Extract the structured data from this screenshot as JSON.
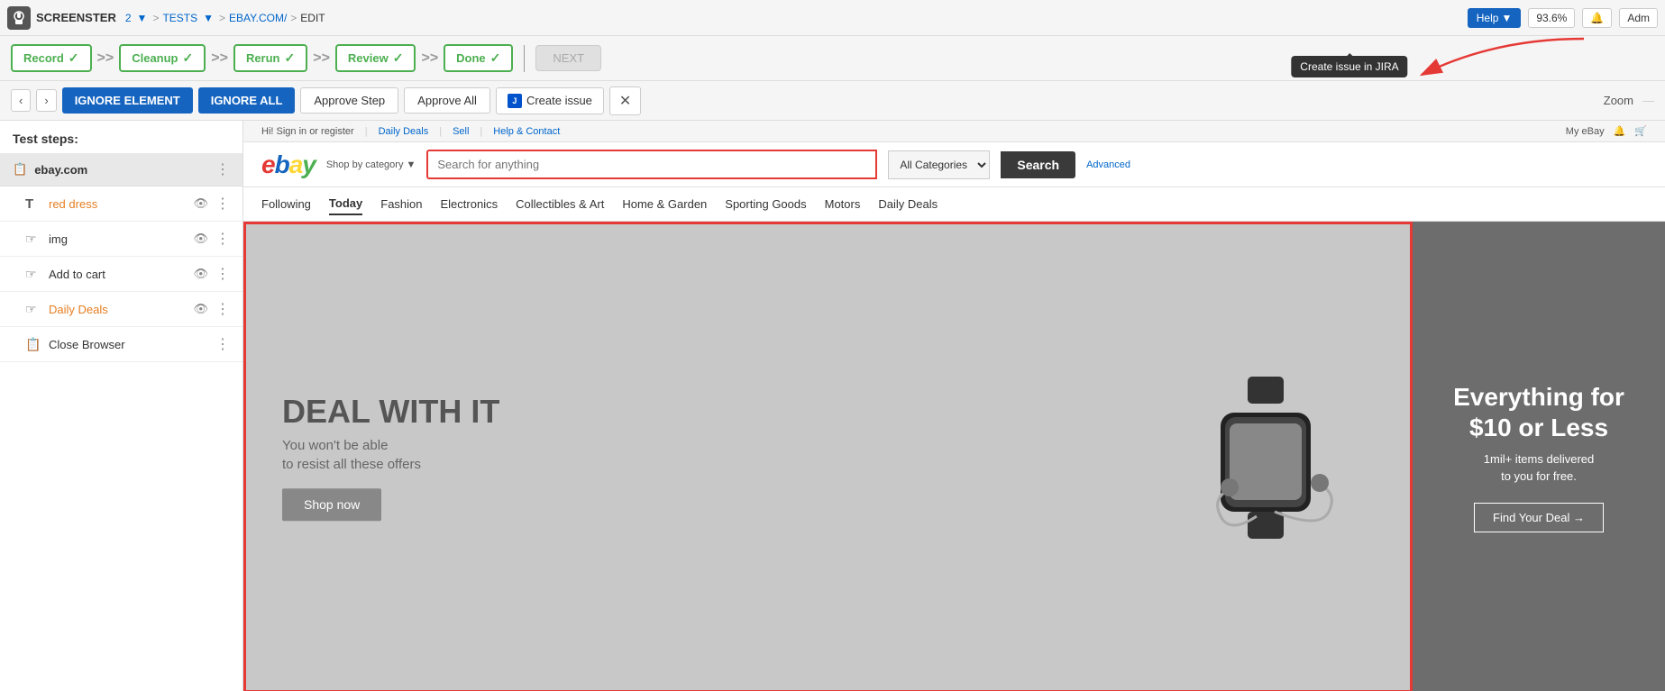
{
  "app": {
    "logo": "S",
    "name": "SCREENSTER"
  },
  "header": {
    "breadcrumb": {
      "num": "2",
      "tests": "TESTS",
      "site": "EBAY.COM/",
      "action": "EDIT"
    },
    "help_label": "Help",
    "zoom": "93.6%",
    "adm": "Adm"
  },
  "workflow": {
    "record_label": "Record",
    "cleanup_label": "Cleanup",
    "rerun_label": "Rerun",
    "review_label": "Review",
    "done_label": "Done",
    "next_label": "NEXT"
  },
  "tooltip": {
    "create_issue_jira": "Create issue in JIRA"
  },
  "action_bar": {
    "ignore_element_label": "IGNORE ELEMENT",
    "ignore_all_label": "IGNORE ALL",
    "approve_step_label": "Approve Step",
    "approve_all_label": "Approve All",
    "create_issue_label": "Create issue",
    "zoom_label": "Zoom"
  },
  "sidebar": {
    "title": "Test steps:",
    "group": {
      "icon": "📋",
      "name": "ebay.com"
    },
    "items": [
      {
        "icon": "T",
        "label": "red dress",
        "color": "orange",
        "type": "text"
      },
      {
        "icon": "👆",
        "label": "img",
        "color": "normal",
        "type": "click"
      },
      {
        "icon": "👆",
        "label": "Add to cart",
        "color": "normal",
        "type": "click"
      },
      {
        "icon": "👆",
        "label": "Daily Deals",
        "color": "orange",
        "type": "click"
      },
      {
        "icon": "📋",
        "label": "Close Browser",
        "color": "normal",
        "type": "browser"
      }
    ]
  },
  "ebay": {
    "topbar": {
      "greeting": "Hi! Sign in or register",
      "daily_deals": "Daily Deals",
      "sell": "Sell",
      "help": "Help & Contact",
      "my_ebay": "My eBay"
    },
    "logo_letters": [
      "e",
      "b",
      "a",
      "y"
    ],
    "shop_by": "Shop by category",
    "search_placeholder": "Search for anything",
    "categories_label": "All Categories",
    "search_btn": "Search",
    "advanced_link": "Advanced",
    "nav_items": [
      "Following",
      "Today",
      "Fashion",
      "Electronics",
      "Collectibles & Art",
      "Home & Garden",
      "Sporting Goods",
      "Motors",
      "Daily Deals"
    ],
    "active_nav": "Today",
    "banner": {
      "main_text": "DEAL WITH IT",
      "sub_text": "You won't be able\nto resist all these offers",
      "shop_btn": "Shop now"
    },
    "promo": {
      "title": "Everything for\n$10 or Less",
      "sub": "1mil+ items delivered\nto you for free.",
      "find_btn": "Find Your Deal →"
    }
  }
}
